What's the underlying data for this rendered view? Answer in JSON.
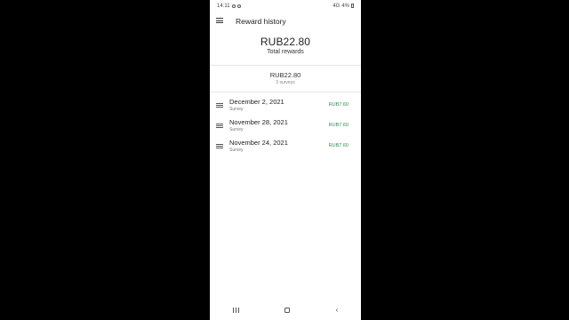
{
  "status_bar": {
    "time": "14:11",
    "signal": "4G",
    "battery": "4%"
  },
  "app_bar": {
    "title": "Reward history"
  },
  "summary": {
    "total_amount": "RUB22.80",
    "total_label": "Total rewards"
  },
  "subtotal": {
    "amount": "RUB22.80",
    "count_label": "3 surveys"
  },
  "rewards": [
    {
      "date": "December 2, 2021",
      "type": "Survey",
      "amount": "RUB7.60"
    },
    {
      "date": "November 28, 2021",
      "type": "Survey",
      "amount": "RUB7.60"
    },
    {
      "date": "November 24, 2021",
      "type": "Survey",
      "amount": "RUB7.60"
    }
  ],
  "colors": {
    "amount_green": "#2e8b57",
    "background": "#000000",
    "screen": "#ffffff"
  },
  "icons": [
    "menu-icon",
    "list-icon",
    "nav-recent-apps-icon",
    "nav-home-icon",
    "nav-back-icon"
  ]
}
